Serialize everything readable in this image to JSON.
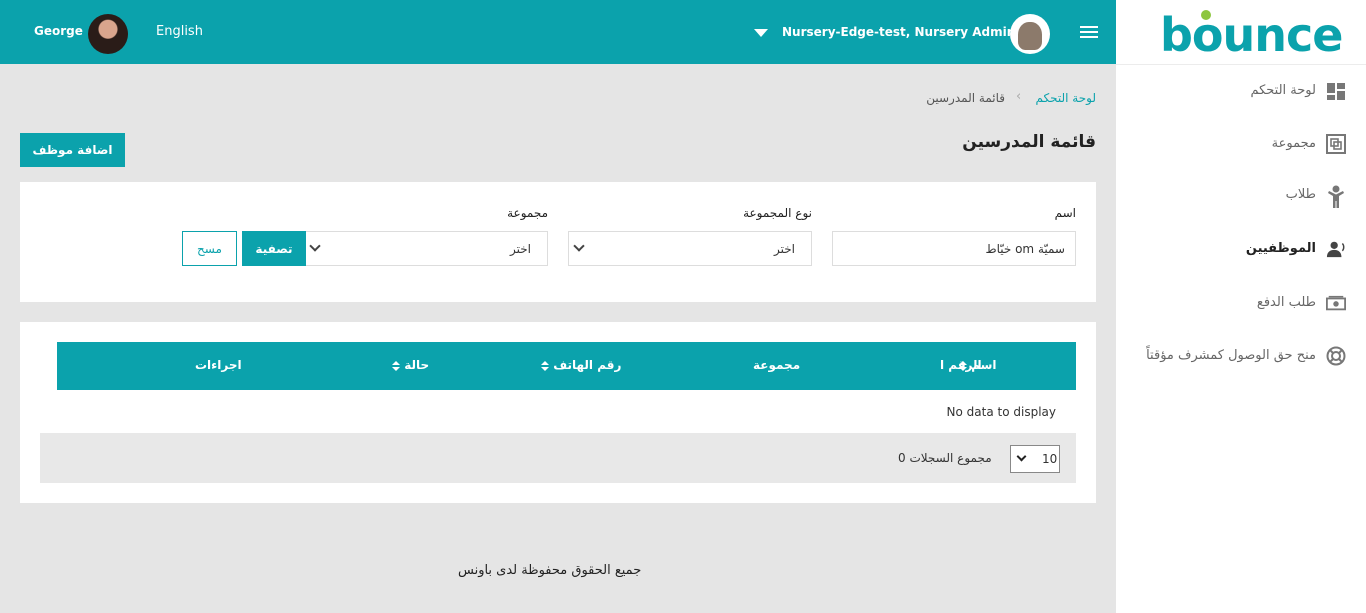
{
  "topbar": {
    "user_name": "George",
    "language": "English",
    "account": "Nursery-Edge-test, Nursery Admin"
  },
  "sidebar": {
    "logo": "bounce",
    "items": [
      {
        "label": "لوحة التحكم",
        "icon": "dashboard-icon"
      },
      {
        "label": "مجموعة",
        "icon": "group-icon"
      },
      {
        "label": "طلاب",
        "icon": "student-icon"
      },
      {
        "label": "الموظفيين",
        "icon": "staff-icon",
        "active": true
      },
      {
        "label": "طلب الدفع",
        "icon": "payment-icon"
      },
      {
        "label": "منح حق الوصول كمشرف مؤقتاً",
        "icon": "support-icon"
      }
    ]
  },
  "breadcrumb": {
    "home": "لوحة التحكم",
    "current": "قائمة المدرسين"
  },
  "page": {
    "title": "قائمة المدرسين",
    "add_button": "اضافة موظف"
  },
  "filters": {
    "name_label": "اسم",
    "name_value": "سميّة om خيّاط",
    "group_type_label": "نوع المجموعة",
    "group_type_value": "اختر",
    "group_label": "مجموعة",
    "group_value": "اختر",
    "filter_button": "تصفية",
    "clear_button": "مسح"
  },
  "table": {
    "columns": [
      "الرقم ا",
      "اسم",
      "مجموعة",
      "رقم الهاتف",
      "حالة",
      "اجراءات"
    ],
    "empty_text": "No data to display",
    "page_size": "10",
    "total_text": "0 مجموع السجلات"
  },
  "footer": {
    "text": "جميع الحقوق محفوظة لدى باونس"
  },
  "colors": {
    "accent": "#0ba2ac",
    "logo_dot": "#8dc63f"
  }
}
